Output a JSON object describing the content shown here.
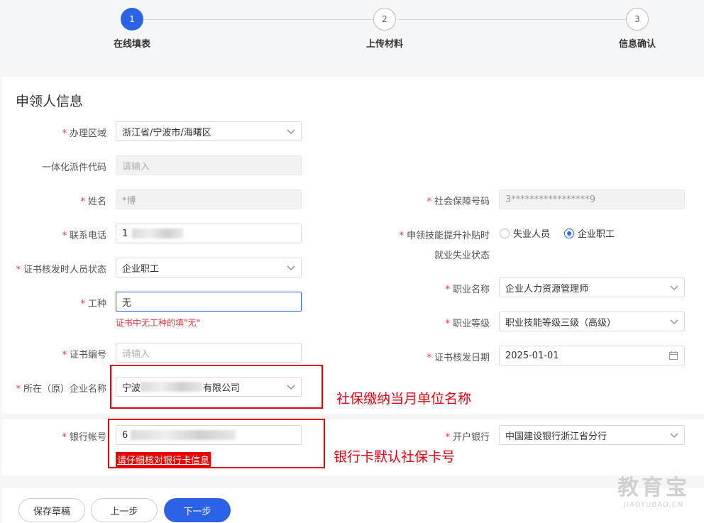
{
  "steps": [
    {
      "num": "1",
      "label": "在线填表"
    },
    {
      "num": "2",
      "label": "上传材料"
    },
    {
      "num": "3",
      "label": "信息确认"
    }
  ],
  "section_title": "申领人信息",
  "fields": {
    "region": {
      "label": "办理区域",
      "value": "浙江省/宁波市/海曙区"
    },
    "dispatch_code": {
      "label": "一体化派件代码",
      "placeholder": "请输入"
    },
    "name": {
      "label": "姓名",
      "value": "*博"
    },
    "social_security": {
      "label": "社会保障号码",
      "value": "3*****************9"
    },
    "phone": {
      "label": "联系电话",
      "value": "1"
    },
    "employment_status": {
      "label_line1": "申领技能提升补贴时",
      "label_line2": "就业失业状态",
      "options": [
        "失业人员",
        "企业职工"
      ],
      "selected": "企业职工"
    },
    "cert_status": {
      "label": "证书核发时人员状态",
      "value": "企业职工"
    },
    "occupation_name": {
      "label": "职业名称",
      "value": "企业人力资源管理师"
    },
    "work_type": {
      "label": "工种",
      "value": "无",
      "hint": "证书中无工种的填\"无\""
    },
    "occupation_level": {
      "label": "职业等级",
      "value": "职业技能等级三级（高级）"
    },
    "cert_number": {
      "label": "证书编号",
      "placeholder": "请输入"
    },
    "cert_date": {
      "label": "证书核发日期",
      "value": "2025-01-01"
    },
    "company": {
      "label": "所在（原）企业名称",
      "value_prefix": "宁波",
      "value_suffix": "有限公司"
    },
    "bank_account": {
      "label": "银行帐号",
      "value": "6",
      "hint": "请仔细核对银行卡信息"
    },
    "bank": {
      "label": "开户银行",
      "value": "中国建设银行浙江省分行"
    }
  },
  "annotations": {
    "company_note": "社保缴纳当月单位名称",
    "bank_note": "银行卡默认社保卡号"
  },
  "buttons": {
    "save_draft": "保存草稿",
    "prev": "上一步",
    "next": "下一步"
  },
  "watermark": {
    "big": "教育宝",
    "small": "JIAOYUBAO.CN"
  },
  "colors": {
    "primary": "#2b63e6",
    "required": "#e4393c",
    "annotation": "#e60012"
  }
}
